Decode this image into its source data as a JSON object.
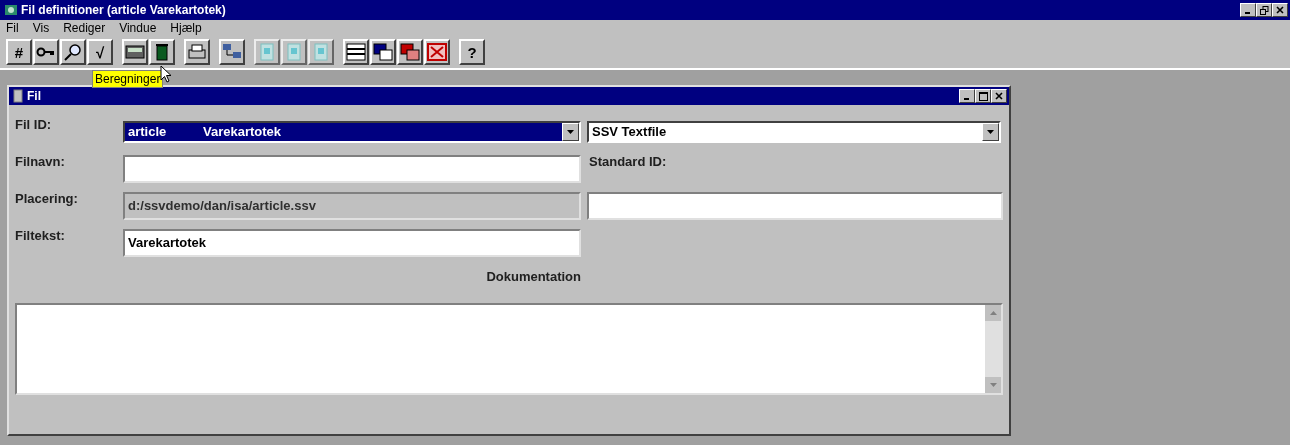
{
  "window": {
    "title": "Fil definitioner (article Varekartotek)"
  },
  "menu": [
    {
      "label": "Fil"
    },
    {
      "label": "Vis"
    },
    {
      "label": "Rediger"
    },
    {
      "label": "Vindue"
    },
    {
      "label": "Hjælp"
    }
  ],
  "toolbar": [
    [
      {
        "kind": "glyph",
        "label": "#"
      },
      {
        "kind": "key"
      },
      {
        "kind": "magnifier"
      },
      {
        "kind": "glyph",
        "label": "√"
      }
    ],
    [
      {
        "kind": "calculator"
      },
      {
        "kind": "trash"
      }
    ],
    [
      {
        "kind": "printer"
      }
    ],
    [
      {
        "kind": "tree"
      }
    ],
    [
      {
        "kind": "page",
        "disabled": true
      },
      {
        "kind": "page",
        "disabled": true
      },
      {
        "kind": "page",
        "disabled": true
      }
    ],
    [
      {
        "kind": "form"
      },
      {
        "kind": "windows"
      },
      {
        "kind": "stacked-windows"
      },
      {
        "kind": "window-close"
      }
    ],
    [
      {
        "kind": "glyph",
        "label": "?"
      }
    ]
  ],
  "tooltip": "Beregninger",
  "child": {
    "title": "Fil",
    "file_id": {
      "label": "Fil ID:",
      "code": "article",
      "name": "Varekartotek",
      "selected": true
    },
    "file_type": {
      "value": "SSV Textfile"
    },
    "filename": {
      "label": "Filnavn:",
      "disabled": false
    },
    "standard_id": {
      "label": "Standard ID:"
    },
    "location": {
      "label": "Placering:",
      "value": "d:/ssvdemo/dan/isa/article.ssv",
      "disabled": true
    },
    "file_text": {
      "label": "Filtekst:",
      "value": "Varekartotek",
      "disabled": false
    },
    "documentation": {
      "label": "Dokumentation"
    }
  }
}
